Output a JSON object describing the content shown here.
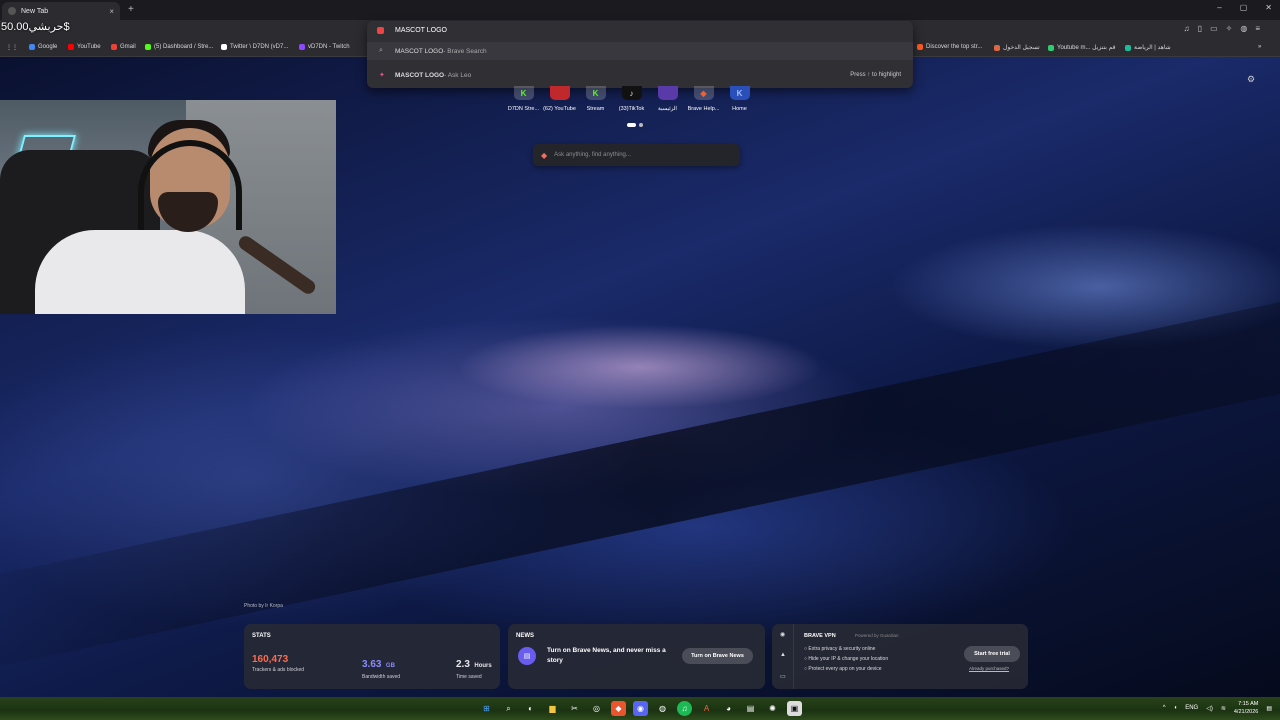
{
  "browser": {
    "tab_title": "New Tab",
    "new_tab_symbol": "+",
    "tab_close_symbol": "×",
    "window_controls": [
      "–",
      "▢",
      "✕"
    ]
  },
  "overlay": {
    "donation_text": "حربشي50.00$"
  },
  "bookmarks": [
    {
      "label": "Google",
      "color": "#4285f4"
    },
    {
      "label": "YouTube",
      "color": "#ff0000"
    },
    {
      "label": "Gmail",
      "color": "#ea4335"
    },
    {
      "label": "(5) Dashboard / Stre...",
      "color": "#53fc18"
    },
    {
      "label": "Twitter \\ D7DN (vD7...",
      "color": "#ffffff"
    },
    {
      "label": "vD7DN - Twitch",
      "color": "#9146ff"
    },
    {
      "label": "Discover the top str...",
      "color": "#ff5a1f"
    },
    {
      "label": "تسجيل الدخول",
      "color": "#d64"
    },
    {
      "label": "Youtube m... قم بتنزيل",
      "color": "#2ecc71"
    },
    {
      "label": "شاهد | الرياضة",
      "color": "#1abc9c"
    }
  ],
  "omnibox": {
    "query": "MASCOT LOGO",
    "suggestions": [
      {
        "main": "MASCOT LOGO",
        "sub": " - Brave Search",
        "icon": "search-icon"
      },
      {
        "main": "MASCOT LOGO",
        "sub": " - Ask Leo",
        "icon": "leo-icon",
        "hint": "Press ↑ to highlight"
      }
    ]
  },
  "top_sites": [
    {
      "label": "D7DN Stre...",
      "glyph": "K",
      "color": "#53fc18"
    },
    {
      "label": "(62) YouTube",
      "glyph": "",
      "color": "#ff2b2b"
    },
    {
      "label": "Stream",
      "glyph": "K",
      "color": "#53fc18"
    },
    {
      "label": "(33)TikTok",
      "glyph": "♪",
      "color": "#111111"
    },
    {
      "label": "الرئيسية",
      "glyph": "",
      "color": "#7a4ad8"
    },
    {
      "label": "Brave Help...",
      "glyph": "◆",
      "color": "#f06030"
    },
    {
      "label": "Home",
      "glyph": "K",
      "color": "#3b82f6"
    }
  ],
  "leo_search": {
    "placeholder": "Ask anything, find anything..."
  },
  "photo_credit": "Photo by Ir Korpa",
  "stats": {
    "title": "STATS",
    "trackers_value": "160,473",
    "trackers_caption": "Trackers & ads blocked",
    "trackers_color": "#ff6a4d",
    "bandwidth_value": "3.63",
    "bandwidth_unit": "GB",
    "bandwidth_caption": "Bandwidth saved",
    "bandwidth_color": "#8a8cff",
    "time_value": "2.3",
    "time_unit": "Hours",
    "time_caption": "Time saved"
  },
  "news": {
    "title": "NEWS",
    "text": "Turn on Brave News, and never miss a story",
    "button": "Turn on Brave News"
  },
  "vpn": {
    "title": "BRAVE VPN",
    "powered_by": "Powered by  Guardian",
    "features": [
      "Extra privacy & security online",
      "Hide your IP & change your location",
      "Protect every app on your device"
    ],
    "button": "Start free trial",
    "link": "Already purchased?"
  },
  "taskbar": {
    "language": "ENG",
    "time": "7:15 AM",
    "date": "4/21/2026"
  }
}
